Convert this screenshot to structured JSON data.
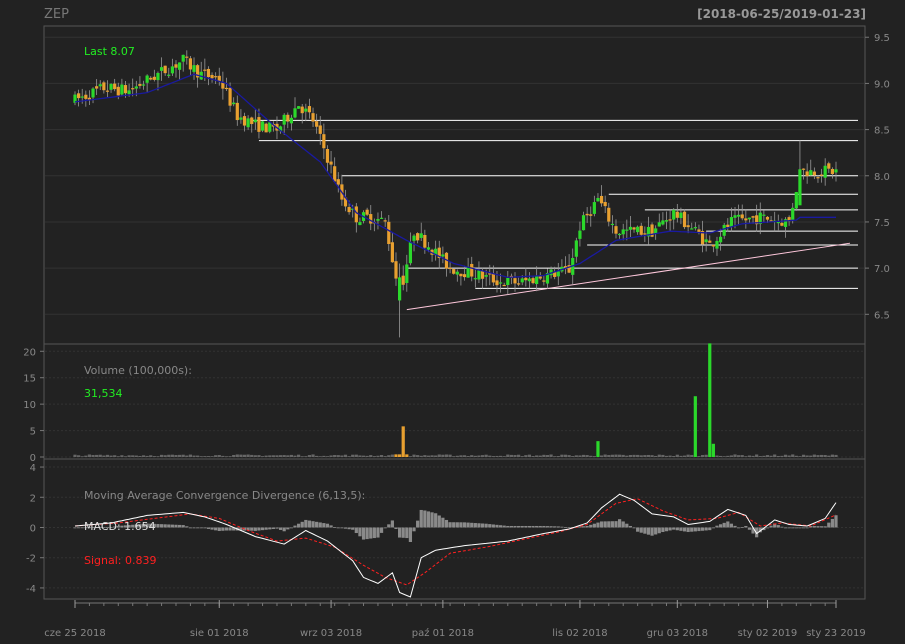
{
  "header": {
    "symbol": "ZEP",
    "range": "[2018-06-25/2019-01-23]"
  },
  "colors": {
    "background": "#222222",
    "panel_border": "#555555",
    "grid": "#333333",
    "text": "#888888",
    "up": "#2bd82b",
    "down": "#e8a030",
    "ema": "#1a1aa0",
    "sr_lines": "#ffffff",
    "trend": "#ffc8dc",
    "macd": "#ffffff",
    "signal": "#ff2020",
    "hist": "#8a8a8a",
    "last_label": "#22ee22",
    "signal_label": "#ff2020"
  },
  "chart_data": [
    {
      "type": "candlestick",
      "panel": "price",
      "last_label": "Last 8.07",
      "ylim": [
        6.2,
        9.6
      ],
      "yticks": [
        "6.5",
        "7.0",
        "7.5",
        "8.0",
        "8.5",
        "9.0",
        "9.5"
      ],
      "grid": true,
      "keypoints": [
        [
          0,
          8.82
        ],
        [
          8,
          8.95
        ],
        [
          15,
          8.92
        ],
        [
          23,
          9.1
        ],
        [
          30,
          9.25
        ],
        [
          35,
          9.1
        ],
        [
          40,
          9.05
        ],
        [
          45,
          8.65
        ],
        [
          50,
          8.55
        ],
        [
          56,
          8.5
        ],
        [
          62,
          8.78
        ],
        [
          66,
          8.6
        ],
        [
          70,
          8.2
        ],
        [
          74,
          7.75
        ],
        [
          78,
          7.55
        ],
        [
          82,
          7.55
        ],
        [
          86,
          7.5
        ],
        [
          90,
          6.7
        ],
        [
          94,
          7.4
        ],
        [
          98,
          7.25
        ],
        [
          104,
          7.0
        ],
        [
          110,
          6.95
        ],
        [
          118,
          6.85
        ],
        [
          124,
          6.85
        ],
        [
          130,
          6.92
        ],
        [
          137,
          6.98
        ],
        [
          140,
          7.45
        ],
        [
          145,
          7.75
        ],
        [
          150,
          7.4
        ],
        [
          160,
          7.4
        ],
        [
          166,
          7.6
        ],
        [
          172,
          7.4
        ],
        [
          176,
          7.25
        ],
        [
          182,
          7.5
        ],
        [
          190,
          7.55
        ],
        [
          198,
          7.5
        ],
        [
          201,
          8.05
        ]
      ],
      "highlights": [
        [
          90,
          6.25,
          7.05,
          6.65,
          6.9
        ],
        [
          201,
          7.7,
          8.38,
          7.68,
          8.07
        ]
      ],
      "ema_keypoints": [
        [
          0,
          8.8
        ],
        [
          20,
          8.9
        ],
        [
          33,
          9.1
        ],
        [
          42,
          9.0
        ],
        [
          55,
          8.55
        ],
        [
          68,
          8.15
        ],
        [
          78,
          7.6
        ],
        [
          92,
          7.3
        ],
        [
          105,
          7.05
        ],
        [
          120,
          6.9
        ],
        [
          130,
          6.92
        ],
        [
          140,
          7.05
        ],
        [
          150,
          7.3
        ],
        [
          165,
          7.4
        ],
        [
          176,
          7.38
        ],
        [
          185,
          7.48
        ],
        [
          200,
          7.52
        ],
        [
          201,
          7.55
        ]
      ],
      "horizontal_lines": [
        {
          "y": 8.6,
          "x0": 49
        },
        {
          "y": 8.38,
          "x0": 51
        },
        {
          "y": 8.0,
          "x0": 74
        },
        {
          "y": 7.8,
          "x0": 148
        },
        {
          "y": 7.63,
          "x0": 158
        },
        {
          "y": 7.4,
          "x0": 175
        },
        {
          "y": 7.25,
          "x0": 142
        },
        {
          "y": 7.0,
          "x0": 92
        },
        {
          "y": 6.78,
          "x0": 111
        }
      ],
      "trendline": [
        [
          92,
          6.55
        ],
        [
          211,
          7.27
        ]
      ]
    },
    {
      "type": "bar",
      "panel": "volume",
      "title": "Volume (100,000s):",
      "value_label": "31,534",
      "ylim": [
        0,
        21
      ],
      "yticks": [
        "0",
        "5",
        "10",
        "15",
        "20"
      ],
      "spikes": [
        [
          91,
          5.8,
          "down"
        ],
        [
          145,
          3.0,
          "up"
        ],
        [
          172,
          11.5,
          "up"
        ],
        [
          176,
          21.5,
          "up"
        ],
        [
          177,
          2.5,
          "up"
        ]
      ],
      "base": 0.35
    },
    {
      "type": "line",
      "panel": "macd",
      "title": "Moving Average Convergence Divergence (6,13,5):",
      "macd_label": "MACD: 1.654",
      "signal_label": "Signal: 0.839",
      "ylim": [
        -4.6,
        4.4
      ],
      "yticks": [
        "4",
        "2",
        "0",
        "-2",
        "-4"
      ],
      "macd_keypoints": [
        [
          0,
          0.1
        ],
        [
          10,
          0.3
        ],
        [
          20,
          0.8
        ],
        [
          30,
          1.0
        ],
        [
          36,
          0.7
        ],
        [
          42,
          0.2
        ],
        [
          50,
          -0.6
        ],
        [
          58,
          -1.1
        ],
        [
          64,
          -0.2
        ],
        [
          70,
          -0.9
        ],
        [
          77,
          -2.2
        ],
        [
          80,
          -3.3
        ],
        [
          84,
          -3.7
        ],
        [
          88,
          -3.0
        ],
        [
          90,
          -4.3
        ],
        [
          93,
          -4.6
        ],
        [
          96,
          -2.0
        ],
        [
          100,
          -1.5
        ],
        [
          108,
          -1.2
        ],
        [
          120,
          -0.9
        ],
        [
          130,
          -0.4
        ],
        [
          137,
          -0.1
        ],
        [
          142,
          0.3
        ],
        [
          146,
          1.3
        ],
        [
          151,
          2.2
        ],
        [
          155,
          1.8
        ],
        [
          160,
          0.9
        ],
        [
          166,
          0.7
        ],
        [
          170,
          0.2
        ],
        [
          176,
          0.4
        ],
        [
          181,
          1.2
        ],
        [
          186,
          0.8
        ],
        [
          189,
          -0.4
        ],
        [
          194,
          0.5
        ],
        [
          198,
          0.2
        ],
        [
          203,
          0.1
        ],
        [
          208,
          0.6
        ],
        [
          211,
          1.65
        ]
      ],
      "signal_keypoints": [
        [
          0,
          0.1
        ],
        [
          12,
          0.3
        ],
        [
          22,
          0.6
        ],
        [
          32,
          0.9
        ],
        [
          40,
          0.6
        ],
        [
          48,
          -0.2
        ],
        [
          56,
          -0.9
        ],
        [
          64,
          -0.7
        ],
        [
          72,
          -1.3
        ],
        [
          80,
          -2.5
        ],
        [
          86,
          -3.3
        ],
        [
          92,
          -3.8
        ],
        [
          97,
          -3.0
        ],
        [
          104,
          -1.7
        ],
        [
          114,
          -1.3
        ],
        [
          124,
          -0.8
        ],
        [
          134,
          -0.3
        ],
        [
          142,
          0.2
        ],
        [
          150,
          1.6
        ],
        [
          156,
          1.9
        ],
        [
          163,
          1.1
        ],
        [
          170,
          0.5
        ],
        [
          178,
          0.6
        ],
        [
          184,
          1.0
        ],
        [
          190,
          0.1
        ],
        [
          196,
          0.3
        ],
        [
          204,
          0.1
        ],
        [
          211,
          0.84
        ]
      ]
    }
  ],
  "x_axis": {
    "ticks": [
      {
        "label": "cze 25 2018",
        "i": 0
      },
      {
        "label": "sie 01 2018",
        "i": 40
      },
      {
        "label": "wrz 03 2018",
        "i": 71
      },
      {
        "label": "paź 01 2018",
        "i": 102
      },
      {
        "label": "lis 02 2018",
        "i": 140
      },
      {
        "label": "gru 03 2018",
        "i": 167
      },
      {
        "label": "sty 02 2019",
        "i": 192
      },
      {
        "label": "sty 23 2019",
        "i": 211
      }
    ],
    "n": 212
  }
}
